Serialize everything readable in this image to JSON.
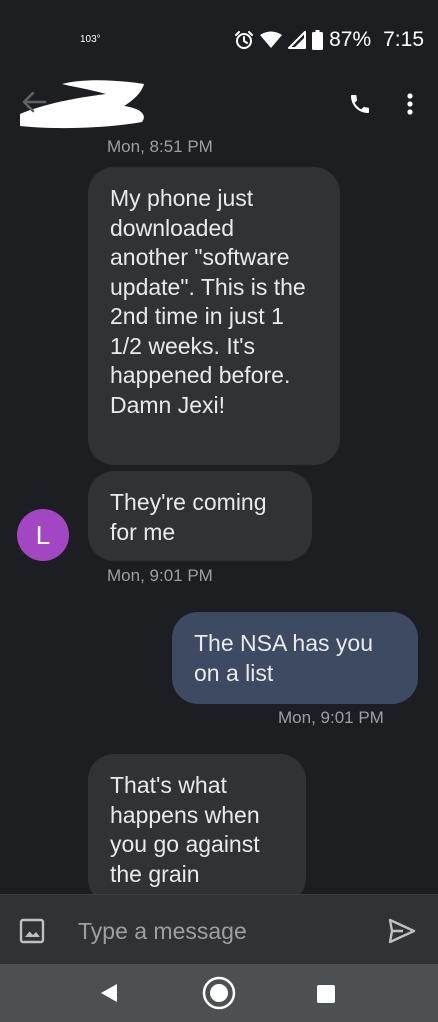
{
  "status_bar": {
    "temperature": "103°",
    "battery_percent": "87%",
    "time": "7:15",
    "icons": [
      "alarm-icon",
      "wifi-icon",
      "signal-icon",
      "battery-icon"
    ]
  },
  "app_bar": {
    "back_icon": "arrow-left-icon",
    "contact_name": "",
    "contact_redacted": true,
    "call_icon": "phone-icon",
    "menu_icon": "more-vertical-icon"
  },
  "thread": {
    "timestamp_1": "Mon, 8:51 PM",
    "msg_1": "My phone just downloaded another \"software update\". This is the 2nd time in just 1 1/2 weeks. It's happened before.\nDamn Jexi!",
    "msg_2": "They're coming for me",
    "avatar_initial": "L",
    "timestamp_2": "Mon, 9:01 PM",
    "msg_3": "The NSA has you on a list",
    "timestamp_3": "Mon, 9:01 PM",
    "msg_4": "That's what happens when you go against the grain"
  },
  "compose": {
    "placeholder": "Type a message",
    "gallery_icon": "image-icon",
    "send_icon": "send-icon"
  },
  "nav_bar": {
    "icons": [
      "nav-back-icon",
      "nav-home-icon",
      "nav-recents-icon"
    ]
  },
  "colors": {
    "background": "#1c1e22",
    "incoming_bubble": "#303236",
    "outgoing_bubble": "#3e4a62",
    "avatar": "#a346c4",
    "timestamp": "#9aa0a6",
    "nav_bar": "#4d5052"
  }
}
